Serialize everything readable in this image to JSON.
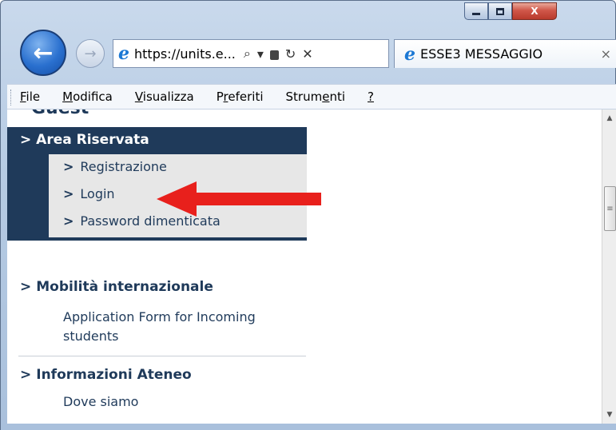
{
  "browser": {
    "address": "https://units.e...",
    "address_icon": "ie-logo-icon",
    "tab_title": "ESSE3 MESSAGGIO",
    "tab_close": "×",
    "back_glyph": "←",
    "forward_glyph": "→",
    "close_glyph": "X",
    "search_glyph": "⌕",
    "dropdown_glyph": "▾",
    "lock_glyph": "🔒",
    "refresh_glyph": "↻",
    "stop_glyph": "✕"
  },
  "menubar": {
    "items": [
      {
        "u": "F",
        "rest": "ile"
      },
      {
        "u": "M",
        "rest": "odifica"
      },
      {
        "u": "V",
        "rest": "isualizza"
      },
      {
        "pre": "P",
        "u": "r",
        "rest": "eferiti"
      },
      {
        "pre": "Strum",
        "u": "e",
        "rest": "nti"
      },
      {
        "u": "?",
        "rest": ""
      }
    ]
  },
  "content": {
    "clipped_heading": "Guest",
    "area_riservata": {
      "title": "Area Riservata",
      "items": [
        "Registrazione",
        "Login",
        "Password dimenticata"
      ]
    },
    "mobilita": {
      "title": "Mobilità internazionale",
      "link_line1": "Application Form for Incoming",
      "link_line2": "students"
    },
    "ateneo": {
      "title": "Informazioni Ateneo",
      "link": "Dove siamo"
    },
    "chevron": ">"
  },
  "colors": {
    "sidebar_dark": "#1f3a5a",
    "sidebar_light": "#e7e7e7",
    "annotation_red": "#e8201c"
  }
}
